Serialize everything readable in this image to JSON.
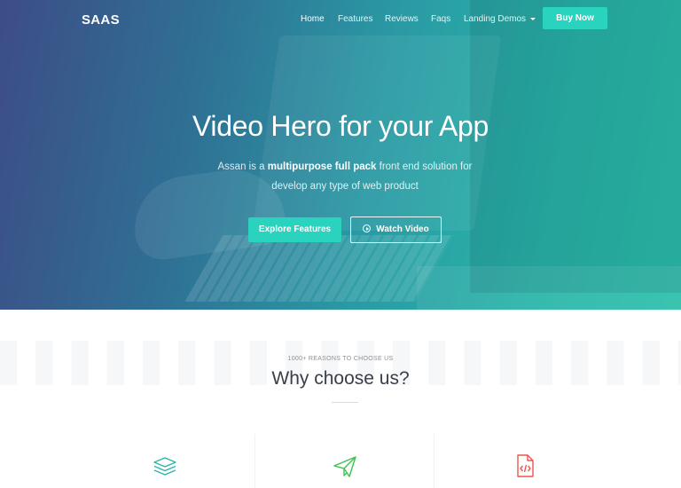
{
  "nav": {
    "brand": "SAAS",
    "items": [
      {
        "label": "Home",
        "active": true
      },
      {
        "label": "Features"
      },
      {
        "label": "Reviews"
      },
      {
        "label": "Faqs"
      },
      {
        "label": "Landing Demos",
        "has_dropdown": true
      }
    ],
    "cta": "Buy Now"
  },
  "hero": {
    "title": "Video Hero for your App",
    "subtitle_pre": "Assan is a ",
    "subtitle_bold": "multipurpose full pack",
    "subtitle_post": " front end solution for develop any type of web product",
    "primary_button": "Explore Features",
    "secondary_button": "Watch Video"
  },
  "features": {
    "eyebrow": "1000+ REASONS TO CHOOSE US",
    "title": "Why choose us?",
    "icons": [
      "layers-icon",
      "paper-plane-icon",
      "code-file-icon"
    ]
  },
  "colors": {
    "accent": "#2ad3bd",
    "hero_gradient_start": "#3d4d86",
    "hero_gradient_end": "#2cc0aa",
    "title_dark": "#3a3f4a",
    "icon_teal": "#2ab5a8",
    "icon_green": "#3bc44e",
    "icon_red": "#e8574e"
  }
}
